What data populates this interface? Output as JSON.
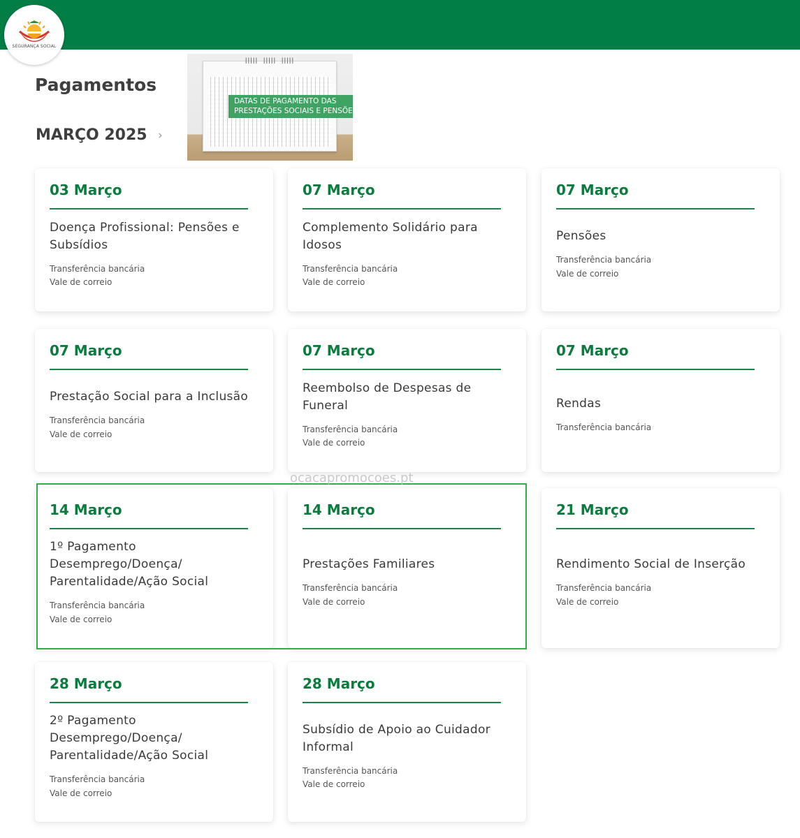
{
  "header": {
    "logo_text": "SEGURANÇA SOCIAL"
  },
  "page_title": "Pagamentos",
  "month": {
    "label": "MARÇO 2025"
  },
  "banner": {
    "label": "DATAS DE PAGAMENTO DAS PRESTAÇÕES SOCIAIS E PENSÕES"
  },
  "cards": [
    {
      "date": "03 Março",
      "title": "Doença Profissional: Pensões e Subsídios",
      "methods": [
        "Transferência bancária",
        "Vale de correio"
      ]
    },
    {
      "date": "07 Março",
      "title": "Complemento Solidário para Idosos",
      "methods": [
        "Transferência bancária",
        "Vale de correio"
      ]
    },
    {
      "date": "07 Março",
      "title": "Pensões",
      "methods": [
        "Transferência bancária",
        "Vale de correio"
      ]
    },
    {
      "date": "07 Março",
      "title": "Prestação Social para a Inclusão",
      "methods": [
        "Transferência bancária",
        "Vale de correio"
      ]
    },
    {
      "date": "07 Março",
      "title": "Reembolso de Despesas de Funeral",
      "methods": [
        "Transferência bancária",
        "Vale de correio"
      ]
    },
    {
      "date": "07 Março",
      "title": "Rendas",
      "methods": [
        "Transferência bancária"
      ]
    },
    {
      "date": "14 Março",
      "title": "1º Pagamento Desemprego/Doença/ Parentalidade/Ação Social",
      "methods": [
        "Transferência bancária",
        "Vale de correio"
      ]
    },
    {
      "date": "14 Março",
      "title": "Prestações Familiares",
      "methods": [
        "Transferência bancária",
        "Vale de correio"
      ]
    },
    {
      "date": "21 Março",
      "title": "Rendimento Social de Inserção",
      "methods": [
        "Transferência bancária",
        "Vale de correio"
      ]
    },
    {
      "date": "28 Março",
      "title": "2º Pagamento Desemprego/Doença/ Parentalidade/Ação Social",
      "methods": [
        "Transferência bancária",
        "Vale de correio"
      ]
    },
    {
      "date": "28 Março",
      "title": "Subsídio de Apoio ao Cuidador Informal",
      "methods": [
        "Transferência bancária",
        "Vale de correio"
      ]
    }
  ],
  "watermark": "ocacapromocoes.pt",
  "colors": {
    "brand_green": "#007e45",
    "date_green": "#0b7c3e",
    "highlight": "#2fae4e"
  }
}
